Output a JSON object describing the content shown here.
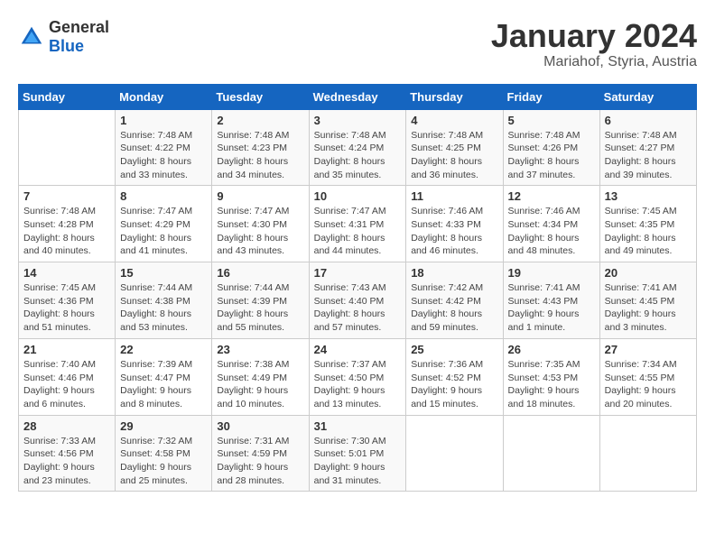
{
  "logo": {
    "general": "General",
    "blue": "Blue"
  },
  "header": {
    "month": "January 2024",
    "location": "Mariahof, Styria, Austria"
  },
  "weekdays": [
    "Sunday",
    "Monday",
    "Tuesday",
    "Wednesday",
    "Thursday",
    "Friday",
    "Saturday"
  ],
  "weeks": [
    [
      {
        "day": "",
        "sunrise": "",
        "sunset": "",
        "daylight": ""
      },
      {
        "day": "1",
        "sunrise": "Sunrise: 7:48 AM",
        "sunset": "Sunset: 4:22 PM",
        "daylight": "Daylight: 8 hours and 33 minutes."
      },
      {
        "day": "2",
        "sunrise": "Sunrise: 7:48 AM",
        "sunset": "Sunset: 4:23 PM",
        "daylight": "Daylight: 8 hours and 34 minutes."
      },
      {
        "day": "3",
        "sunrise": "Sunrise: 7:48 AM",
        "sunset": "Sunset: 4:24 PM",
        "daylight": "Daylight: 8 hours and 35 minutes."
      },
      {
        "day": "4",
        "sunrise": "Sunrise: 7:48 AM",
        "sunset": "Sunset: 4:25 PM",
        "daylight": "Daylight: 8 hours and 36 minutes."
      },
      {
        "day": "5",
        "sunrise": "Sunrise: 7:48 AM",
        "sunset": "Sunset: 4:26 PM",
        "daylight": "Daylight: 8 hours and 37 minutes."
      },
      {
        "day": "6",
        "sunrise": "Sunrise: 7:48 AM",
        "sunset": "Sunset: 4:27 PM",
        "daylight": "Daylight: 8 hours and 39 minutes."
      }
    ],
    [
      {
        "day": "7",
        "sunrise": "Sunrise: 7:48 AM",
        "sunset": "Sunset: 4:28 PM",
        "daylight": "Daylight: 8 hours and 40 minutes."
      },
      {
        "day": "8",
        "sunrise": "Sunrise: 7:47 AM",
        "sunset": "Sunset: 4:29 PM",
        "daylight": "Daylight: 8 hours and 41 minutes."
      },
      {
        "day": "9",
        "sunrise": "Sunrise: 7:47 AM",
        "sunset": "Sunset: 4:30 PM",
        "daylight": "Daylight: 8 hours and 43 minutes."
      },
      {
        "day": "10",
        "sunrise": "Sunrise: 7:47 AM",
        "sunset": "Sunset: 4:31 PM",
        "daylight": "Daylight: 8 hours and 44 minutes."
      },
      {
        "day": "11",
        "sunrise": "Sunrise: 7:46 AM",
        "sunset": "Sunset: 4:33 PM",
        "daylight": "Daylight: 8 hours and 46 minutes."
      },
      {
        "day": "12",
        "sunrise": "Sunrise: 7:46 AM",
        "sunset": "Sunset: 4:34 PM",
        "daylight": "Daylight: 8 hours and 48 minutes."
      },
      {
        "day": "13",
        "sunrise": "Sunrise: 7:45 AM",
        "sunset": "Sunset: 4:35 PM",
        "daylight": "Daylight: 8 hours and 49 minutes."
      }
    ],
    [
      {
        "day": "14",
        "sunrise": "Sunrise: 7:45 AM",
        "sunset": "Sunset: 4:36 PM",
        "daylight": "Daylight: 8 hours and 51 minutes."
      },
      {
        "day": "15",
        "sunrise": "Sunrise: 7:44 AM",
        "sunset": "Sunset: 4:38 PM",
        "daylight": "Daylight: 8 hours and 53 minutes."
      },
      {
        "day": "16",
        "sunrise": "Sunrise: 7:44 AM",
        "sunset": "Sunset: 4:39 PM",
        "daylight": "Daylight: 8 hours and 55 minutes."
      },
      {
        "day": "17",
        "sunrise": "Sunrise: 7:43 AM",
        "sunset": "Sunset: 4:40 PM",
        "daylight": "Daylight: 8 hours and 57 minutes."
      },
      {
        "day": "18",
        "sunrise": "Sunrise: 7:42 AM",
        "sunset": "Sunset: 4:42 PM",
        "daylight": "Daylight: 8 hours and 59 minutes."
      },
      {
        "day": "19",
        "sunrise": "Sunrise: 7:41 AM",
        "sunset": "Sunset: 4:43 PM",
        "daylight": "Daylight: 9 hours and 1 minute."
      },
      {
        "day": "20",
        "sunrise": "Sunrise: 7:41 AM",
        "sunset": "Sunset: 4:45 PM",
        "daylight": "Daylight: 9 hours and 3 minutes."
      }
    ],
    [
      {
        "day": "21",
        "sunrise": "Sunrise: 7:40 AM",
        "sunset": "Sunset: 4:46 PM",
        "daylight": "Daylight: 9 hours and 6 minutes."
      },
      {
        "day": "22",
        "sunrise": "Sunrise: 7:39 AM",
        "sunset": "Sunset: 4:47 PM",
        "daylight": "Daylight: 9 hours and 8 minutes."
      },
      {
        "day": "23",
        "sunrise": "Sunrise: 7:38 AM",
        "sunset": "Sunset: 4:49 PM",
        "daylight": "Daylight: 9 hours and 10 minutes."
      },
      {
        "day": "24",
        "sunrise": "Sunrise: 7:37 AM",
        "sunset": "Sunset: 4:50 PM",
        "daylight": "Daylight: 9 hours and 13 minutes."
      },
      {
        "day": "25",
        "sunrise": "Sunrise: 7:36 AM",
        "sunset": "Sunset: 4:52 PM",
        "daylight": "Daylight: 9 hours and 15 minutes."
      },
      {
        "day": "26",
        "sunrise": "Sunrise: 7:35 AM",
        "sunset": "Sunset: 4:53 PM",
        "daylight": "Daylight: 9 hours and 18 minutes."
      },
      {
        "day": "27",
        "sunrise": "Sunrise: 7:34 AM",
        "sunset": "Sunset: 4:55 PM",
        "daylight": "Daylight: 9 hours and 20 minutes."
      }
    ],
    [
      {
        "day": "28",
        "sunrise": "Sunrise: 7:33 AM",
        "sunset": "Sunset: 4:56 PM",
        "daylight": "Daylight: 9 hours and 23 minutes."
      },
      {
        "day": "29",
        "sunrise": "Sunrise: 7:32 AM",
        "sunset": "Sunset: 4:58 PM",
        "daylight": "Daylight: 9 hours and 25 minutes."
      },
      {
        "day": "30",
        "sunrise": "Sunrise: 7:31 AM",
        "sunset": "Sunset: 4:59 PM",
        "daylight": "Daylight: 9 hours and 28 minutes."
      },
      {
        "day": "31",
        "sunrise": "Sunrise: 7:30 AM",
        "sunset": "Sunset: 5:01 PM",
        "daylight": "Daylight: 9 hours and 31 minutes."
      },
      {
        "day": "",
        "sunrise": "",
        "sunset": "",
        "daylight": ""
      },
      {
        "day": "",
        "sunrise": "",
        "sunset": "",
        "daylight": ""
      },
      {
        "day": "",
        "sunrise": "",
        "sunset": "",
        "daylight": ""
      }
    ]
  ]
}
